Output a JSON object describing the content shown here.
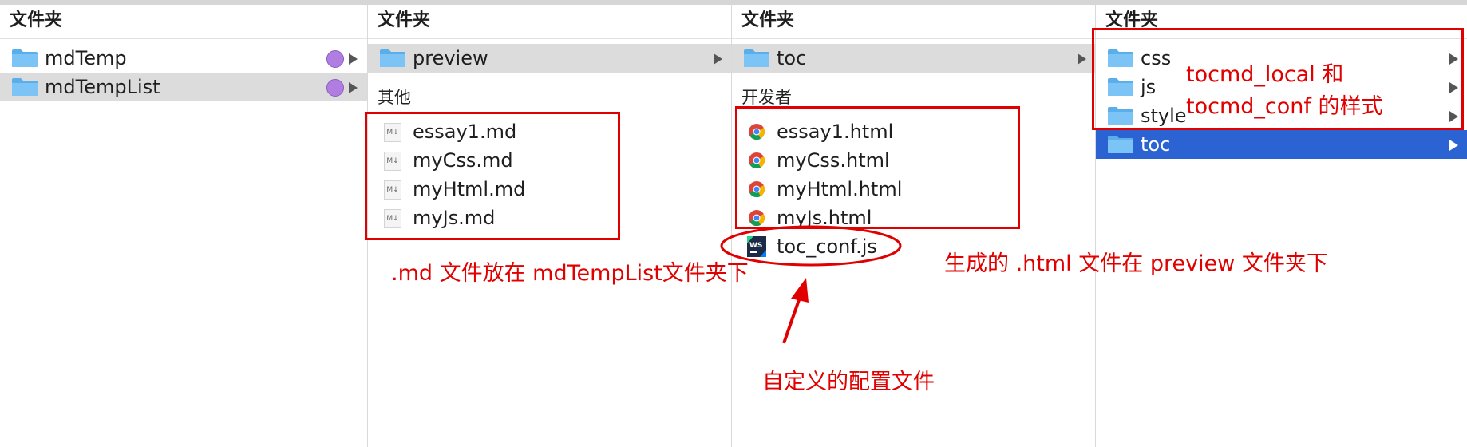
{
  "columns": [
    {
      "header": "文件夹",
      "rows": [
        {
          "name": "mdTemp"
        },
        {
          "name": "mdTempList"
        }
      ]
    },
    {
      "header": "文件夹",
      "folder": {
        "name": "preview"
      },
      "section": "其他",
      "files": [
        "essay1.md",
        "myCss.md",
        "myHtml.md",
        "myJs.md"
      ],
      "md_icon_text": "M↓"
    },
    {
      "header": "文件夹",
      "folder": {
        "name": "toc"
      },
      "section": "开发者",
      "files": [
        "essay1.html",
        "myCss.html",
        "myHtml.html",
        "myJs.html"
      ],
      "extra_file": "toc_conf.js",
      "ws_icon_text": "WS"
    },
    {
      "header": "文件夹",
      "rows": [
        {
          "name": "css"
        },
        {
          "name": "js"
        },
        {
          "name": "style"
        },
        {
          "name": "toc"
        }
      ]
    }
  ],
  "annotations": {
    "md_note": ".md 文件放在 mdTempList文件夹下",
    "html_note": "生成的 .html 文件在 preview 文件夹下",
    "conf_note": "自定义的配置文件",
    "style_note_line1": "tocmd_local 和",
    "style_note_line2": "tocmd_conf 的样式"
  },
  "colors": {
    "annotation_red": "#e00000",
    "selection_blue": "#2c63d2",
    "tag_purple": "#b07ee0",
    "folder_blue": "#6bb6f0"
  }
}
